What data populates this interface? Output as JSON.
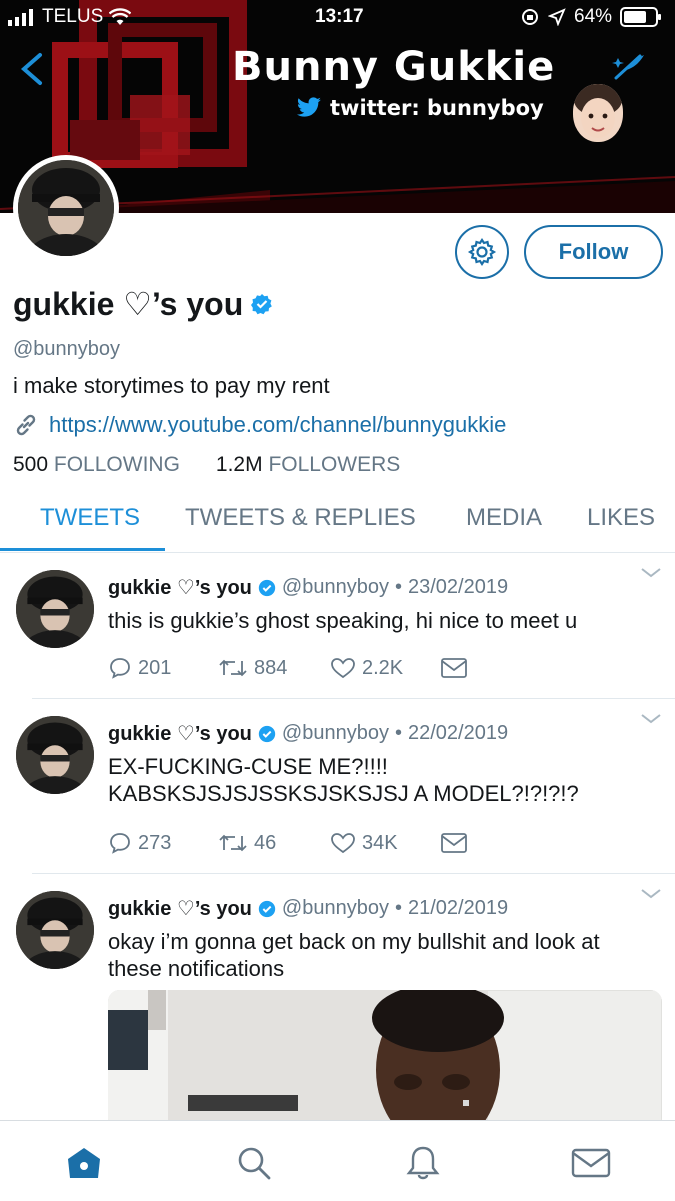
{
  "status_bar": {
    "carrier": "TELUS",
    "time": "13:17",
    "battery": "64%"
  },
  "header": {
    "title": "Bunny Gukkie",
    "subtitle": "twitter: bunnyboy"
  },
  "profile": {
    "display_name": "gukkie ♡’s you",
    "handle": "@bunnyboy",
    "bio": "i make storytimes to pay my rent",
    "link": "https://www.youtube.com/channel/bunnygukkie",
    "following_count": "500",
    "following_label": "FOLLOWING",
    "followers_count": "1.2M",
    "followers_label": "FOLLOWERS",
    "follow_label": "Follow"
  },
  "tabs": [
    {
      "label": "TWEETS",
      "active": true
    },
    {
      "label": "TWEETS & REPLIES",
      "active": false
    },
    {
      "label": "MEDIA",
      "active": false
    },
    {
      "label": "LIKES",
      "active": false
    }
  ],
  "tweets": [
    {
      "name": "gukkie ♡’s you",
      "handle": "@bunnyboy",
      "date": "23/02/2019",
      "text": "this is gukkie’s ghost speaking, hi nice to meet u",
      "replies": "201",
      "retweets": "884",
      "likes": "2.2K"
    },
    {
      "name": "gukkie ♡’s you",
      "handle": "@bunnyboy",
      "date": "22/02/2019",
      "text": "EX-FUCKING-CUSE ME?!!!! KABSKSJSJSJSSKSJSKSJSJ A MODEL?!?!?!?",
      "replies": "273",
      "retweets": "46",
      "likes": "34K"
    },
    {
      "name": "gukkie ♡’s you",
      "handle": "@bunnyboy",
      "date": "21/02/2019",
      "text": "okay i’m gonna get back on my bullshit and look at these notifications"
    }
  ],
  "colors": {
    "accent": "#1d8fd8",
    "button_border": "#1b6fa8",
    "verified": "#1da1f2",
    "muted": "#657786",
    "banner_bg": "#050505",
    "banner_red": "#8a0d12"
  },
  "icons": {
    "back": "chevron-left-icon",
    "compose": "sparkle-feather-icon",
    "settings": "gear-icon",
    "link": "link-icon",
    "reply": "reply-bubble-icon",
    "retweet": "retweet-icon",
    "like": "heart-icon",
    "dm": "envelope-icon",
    "nav": [
      "home-icon",
      "search-icon",
      "bell-icon",
      "mail-icon"
    ]
  }
}
